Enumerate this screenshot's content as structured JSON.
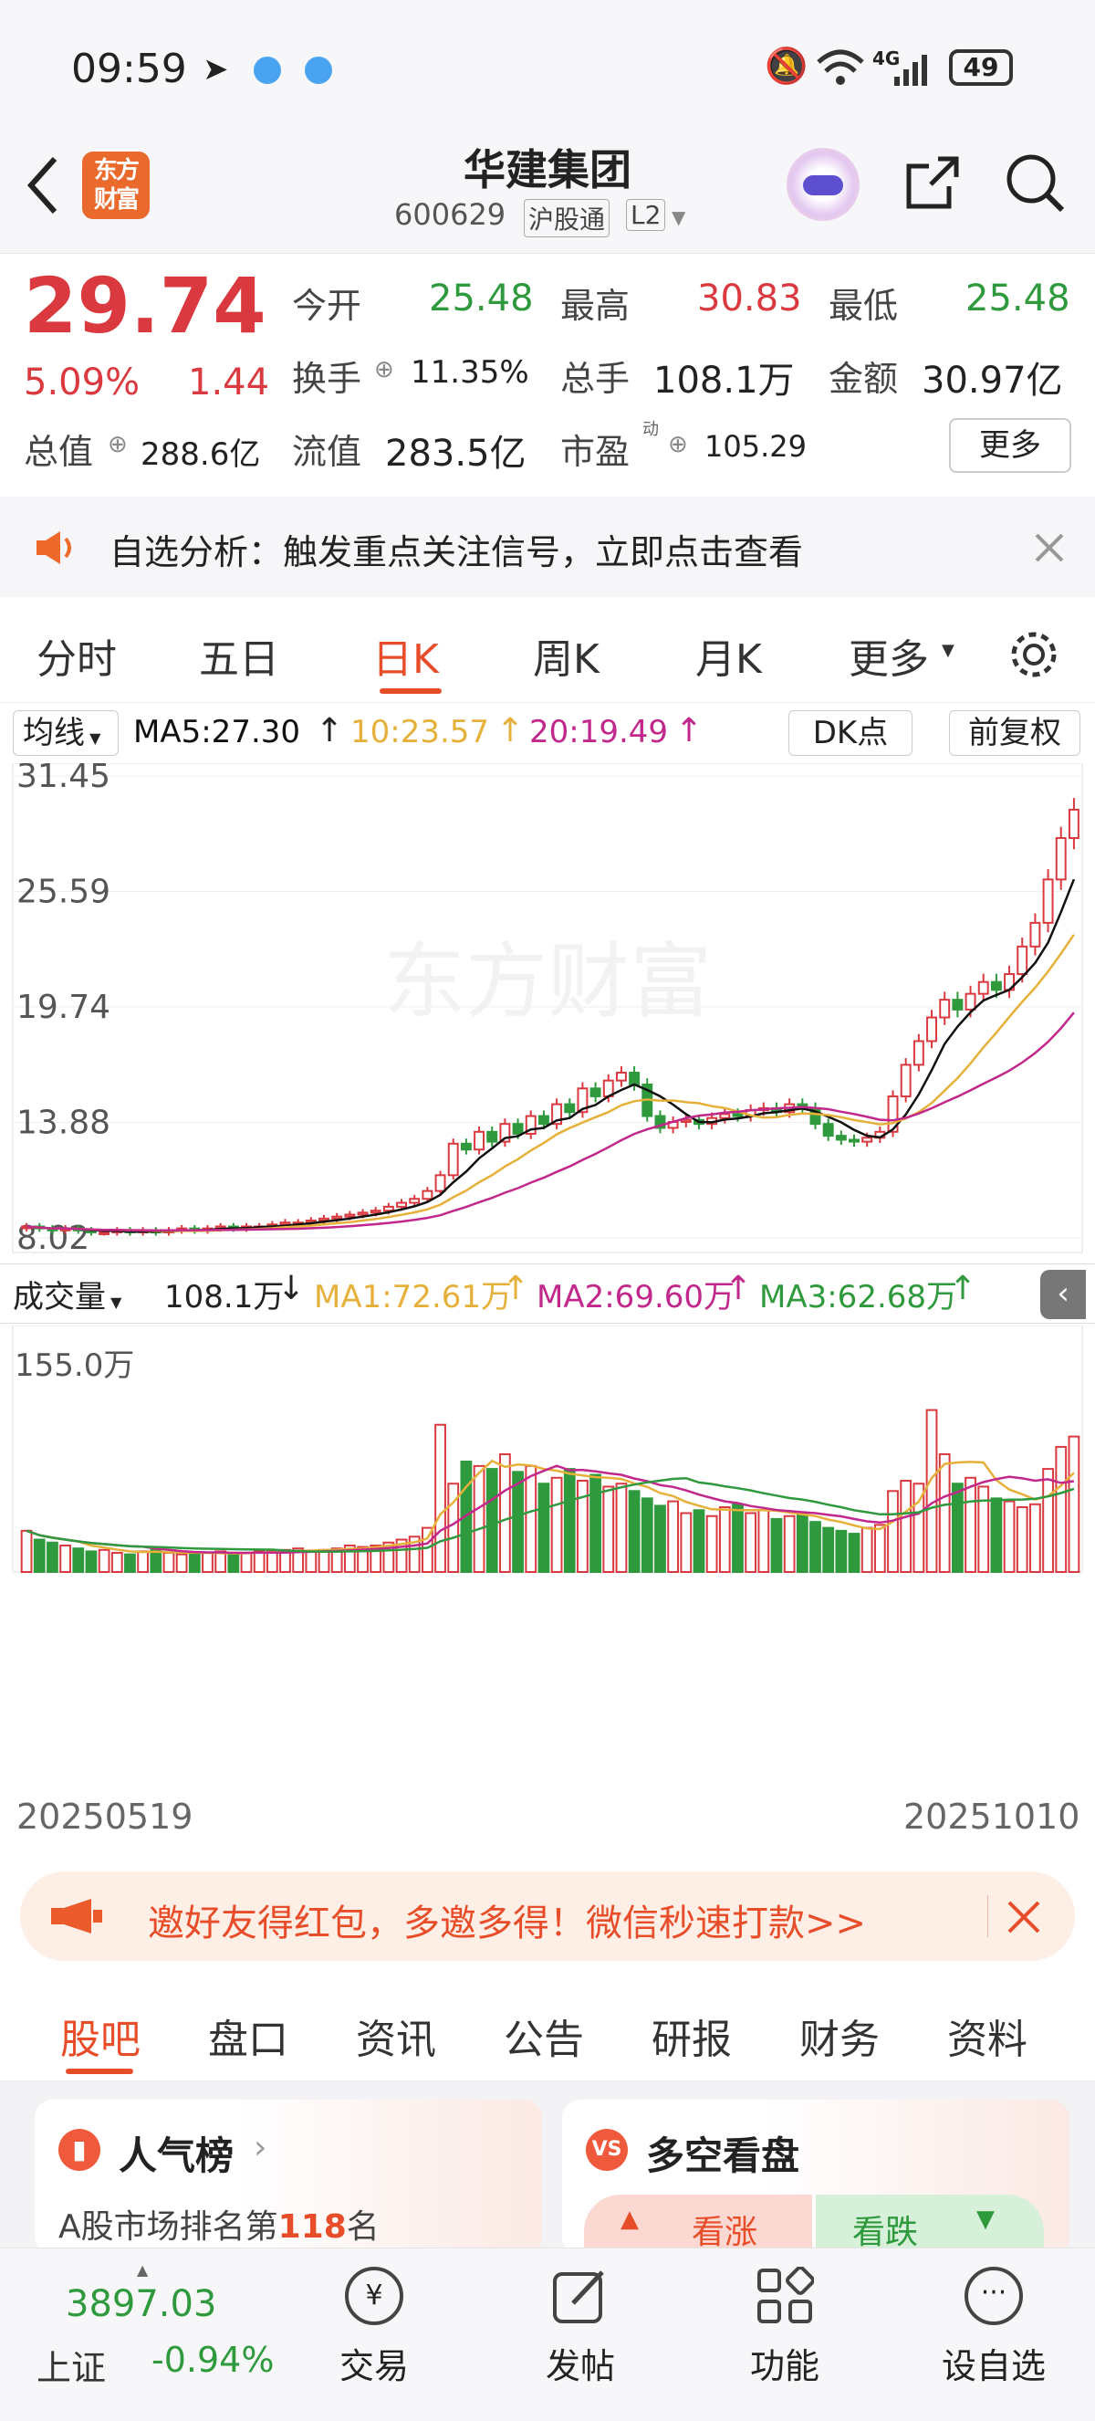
{
  "status": {
    "time": "09:59",
    "battery": "49",
    "network": "4G"
  },
  "header": {
    "title": "华建集团",
    "code": "600629",
    "tag1": "沪股通",
    "tag2": "L2",
    "logo_text": "东方财富"
  },
  "quote": {
    "price": "29.74",
    "pct": "5.09%",
    "chg": "1.44",
    "open_label": "今开",
    "open": "25.48",
    "high_label": "最高",
    "high": "30.83",
    "low_label": "最低",
    "low": "25.48",
    "turnover_label": "换手",
    "turnover": "11.35%",
    "volume_label": "总手",
    "volume": "108.1万",
    "amount_label": "金额",
    "amount": "30.97亿",
    "mcap_label": "总值",
    "mcap": "288.6亿",
    "float_label": "流值",
    "float": "283.5亿",
    "pe_label": "市盈",
    "pe_sup": "动",
    "pe": "105.29",
    "more": "更多"
  },
  "notice": {
    "text": "自选分析：触发重点关注信号，立即点击查看"
  },
  "tabs": [
    {
      "label": "分时"
    },
    {
      "label": "五日"
    },
    {
      "label": "日K"
    },
    {
      "label": "周K"
    },
    {
      "label": "月K"
    },
    {
      "label": "更多"
    }
  ],
  "chart_head": {
    "indicator": "均线",
    "ma5": "MA5:27.30",
    "ma10": "10:23.57",
    "ma20": "20:19.49",
    "dk": "DK点",
    "adjust": "前复权"
  },
  "chart_data": {
    "type": "candlestick",
    "y_ticks": [
      "31.45",
      "25.59",
      "19.74",
      "13.88",
      "8.02"
    ],
    "ylim": [
      8.02,
      31.45
    ],
    "x_start": "20250519",
    "x_end": "20251010",
    "watermark": "东方财富",
    "closes": [
      8.6,
      8.5,
      8.4,
      8.5,
      8.4,
      8.3,
      8.3,
      8.4,
      8.3,
      8.4,
      8.3,
      8.4,
      8.5,
      8.4,
      8.5,
      8.6,
      8.5,
      8.6,
      8.6,
      8.7,
      8.8,
      8.8,
      8.9,
      9.0,
      9.1,
      9.2,
      9.3,
      9.4,
      9.6,
      9.8,
      10.0,
      10.4,
      11.2,
      12.8,
      12.5,
      13.4,
      12.9,
      13.8,
      13.3,
      14.2,
      13.8,
      14.8,
      14.4,
      15.6,
      15.2,
      16.0,
      16.4,
      15.8,
      14.2,
      13.6,
      13.9,
      14.0,
      13.8,
      14.1,
      14.3,
      14.2,
      14.5,
      14.6,
      14.4,
      14.8,
      14.6,
      13.8,
      13.2,
      13.0,
      12.9,
      13.1,
      13.4,
      15.2,
      16.8,
      18.0,
      19.2,
      20.1,
      19.6,
      20.4,
      21.0,
      20.6,
      21.4,
      22.8,
      24.0,
      26.2,
      28.3,
      29.74
    ]
  },
  "volume_head": {
    "label": "成交量",
    "value": "108.1万",
    "ma1": "MA1:72.61万",
    "ma2": "MA2:69.60万",
    "ma3": "MA3:62.68万",
    "max": "155.0万"
  },
  "volume_data": [
    28,
    22,
    20,
    18,
    16,
    14,
    15,
    13,
    12,
    14,
    15,
    13,
    12,
    12,
    13,
    14,
    12,
    13,
    14,
    14,
    15,
    16,
    14,
    15,
    16,
    18,
    17,
    18,
    20,
    22,
    24,
    30,
    100,
    60,
    75,
    72,
    70,
    80,
    68,
    72,
    60,
    64,
    70,
    62,
    66,
    58,
    60,
    55,
    50,
    45,
    48,
    40,
    42,
    38,
    44,
    46,
    40,
    42,
    36,
    38,
    40,
    34,
    30,
    28,
    26,
    30,
    32,
    55,
    62,
    60,
    110,
    80,
    60,
    64,
    58,
    50,
    48,
    44,
    46,
    70,
    85,
    92
  ],
  "promo": {
    "text": "邀好友得红包，多邀多得！微信秒速打款>>"
  },
  "subtabs": [
    {
      "label": "股吧"
    },
    {
      "label": "盘口"
    },
    {
      "label": "资讯"
    },
    {
      "label": "公告"
    },
    {
      "label": "研报"
    },
    {
      "label": "财务"
    },
    {
      "label": "资料"
    }
  ],
  "cards": {
    "popular_title": "人气榜",
    "rank_prefix": "A股市场排名第",
    "rank_num": "118",
    "rank_suffix": "名",
    "bull_title": "多空看盘",
    "bull": "看涨",
    "bear": "看跌"
  },
  "bottom": {
    "index_value": "3897.03",
    "index_name": "上证",
    "index_pct": "-0.94%",
    "trade": "交易",
    "post": "发帖",
    "func": "功能",
    "watch": "设自选"
  }
}
